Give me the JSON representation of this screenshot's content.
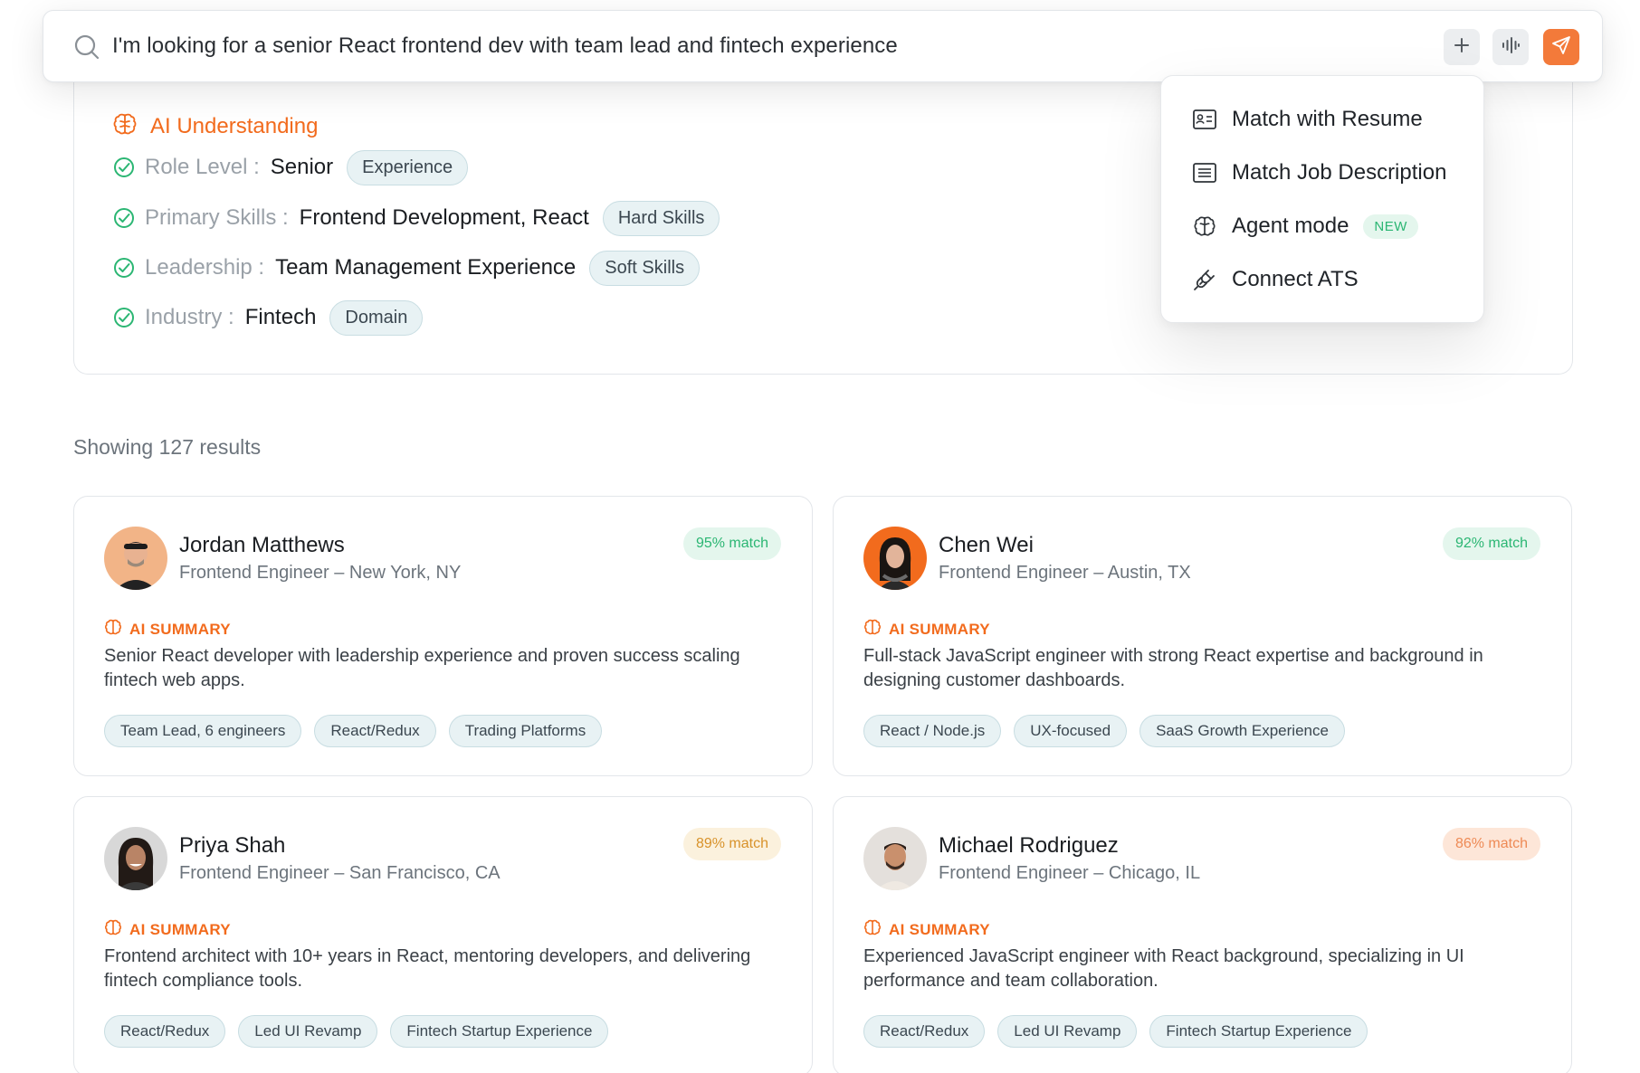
{
  "search": {
    "query": "I'm looking for a senior React frontend dev with team lead and fintech experience",
    "icon": "search-icon",
    "buttons": [
      "plus-icon",
      "voice-icon",
      "send-icon"
    ],
    "accent": "#f37a3a"
  },
  "ai_understanding": {
    "title": "AI Understanding",
    "criteria": [
      {
        "label": "Role Level :",
        "value": "Senior",
        "tag": "Experience"
      },
      {
        "label": "Primary Skills :",
        "value": "Frontend Development, React",
        "tag": "Hard Skills"
      },
      {
        "label": "Leadership :",
        "value": "Team Management Experience",
        "tag": "Soft Skills"
      },
      {
        "label": "Industry :",
        "value": "Fintech",
        "tag": "Domain"
      }
    ]
  },
  "menu": {
    "items": [
      {
        "label": "Match with Resume",
        "icon": "resume-icon"
      },
      {
        "label": "Match Job Description",
        "icon": "document-icon"
      },
      {
        "label": "Agent mode",
        "icon": "brain-icon",
        "badge": "NEW"
      },
      {
        "label": "Connect ATS",
        "icon": "plug-icon"
      }
    ]
  },
  "results": {
    "count_text": "Showing 127 results",
    "ai_summary_label": "AI SUMMARY",
    "candidates": [
      {
        "name": "Jordan Matthews",
        "role": "Frontend Engineer – New York, NY",
        "match": "95% match",
        "match_color": "#2bb673",
        "summary": "Senior React developer with leadership experience and proven success scaling fintech web apps.",
        "chips": [
          "Team Lead, 6 engineers",
          "React/Redux",
          "Trading Platforms"
        ]
      },
      {
        "name": "Chen Wei",
        "role": "Frontend Engineer – Austin, TX",
        "match": "92% match",
        "match_color": "#2bb673",
        "summary": "Full-stack JavaScript engineer with strong React expertise and background in designing customer dashboards.",
        "chips": [
          "React / Node.js",
          "UX-focused",
          "SaaS Growth Experience"
        ]
      },
      {
        "name": "Priya Shah",
        "role": "Frontend Engineer – San Francisco, CA",
        "match": "89% match",
        "match_color": "#d8922a",
        "summary": "Frontend architect with 10+ years in React, mentoring developers, and delivering fintech compliance tools.",
        "chips": [
          "React/Redux",
          "Led UI Revamp",
          "Fintech Startup Experience"
        ]
      },
      {
        "name": "Michael Rodriguez",
        "role": "Frontend Engineer – Chicago, IL",
        "match": "86% match",
        "match_color": "#ee8a55",
        "summary": "Experienced JavaScript engineer with React background, specializing in UI performance and team collaboration.",
        "chips": [
          "React/Redux",
          "Led UI Revamp",
          "Fintech Startup Experience"
        ]
      }
    ]
  }
}
